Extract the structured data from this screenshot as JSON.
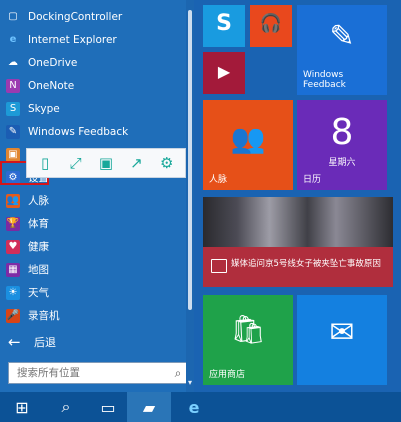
{
  "apps": [
    {
      "label": "DockingController",
      "icon": "app-icon",
      "color": "#1f6eb9"
    },
    {
      "label": "Internet Explorer",
      "icon": "internet-explorer-icon",
      "color": "#2f7ad5"
    },
    {
      "label": "OneDrive",
      "icon": "cloud-icon",
      "color": "#2b7ad1"
    },
    {
      "label": "OneNote",
      "icon": "onenote-icon",
      "color": "#9b3ab0"
    },
    {
      "label": "Skype",
      "icon": "skype-icon",
      "color": "#1d9ad7"
    },
    {
      "label": "Windows Feedback",
      "icon": "feedback-icon",
      "color": "#1b5db3"
    },
    {
      "label": "",
      "icon": "blank",
      "color": "#1f6eb9"
    },
    {
      "label": "设置",
      "icon": "gear-icon",
      "color": "#2c6ad2"
    },
    {
      "label": "人脉",
      "icon": "people-icon",
      "color": "#e35b1c"
    },
    {
      "label": "体育",
      "icon": "trophy-icon",
      "color": "#7b2aa1"
    },
    {
      "label": "健康",
      "icon": "heart-icon",
      "color": "#d12e5a"
    },
    {
      "label": "地图",
      "icon": "map-icon",
      "color": "#7e2ba6"
    },
    {
      "label": "天气",
      "icon": "sun-icon",
      "color": "#1a8fe0"
    },
    {
      "label": "录音机",
      "icon": "mic-icon",
      "color": "#d74416"
    }
  ],
  "toolbar": [
    {
      "name": "tablet-icon",
      "glyph": "▯"
    },
    {
      "name": "expand-icon",
      "glyph": "⤢"
    },
    {
      "name": "save-icon",
      "glyph": "▣"
    },
    {
      "name": "share-icon",
      "glyph": "↗"
    },
    {
      "name": "gear-icon",
      "glyph": "⚙"
    }
  ],
  "back": {
    "label": "后退"
  },
  "search": {
    "placeholder": "搜索所有位置"
  },
  "tiles": {
    "skype": {
      "glyph": "S",
      "color": "#199be0"
    },
    "music": {
      "glyph": "🎧",
      "color": "#e9481d"
    },
    "video": {
      "glyph": "▶",
      "color": "#a31a3a"
    },
    "feedback": {
      "label_line1": "Windows",
      "label_line2": "Feedback",
      "color": "#1a6fd6"
    },
    "people": {
      "label": "人脉",
      "color": "#e65018"
    },
    "calendar": {
      "number": "8",
      "weekday": "星期六",
      "label": "日历",
      "color": "#6a2bb8"
    },
    "news": {
      "text": "媒体追问京5号线女子被夹坠亡事故原因",
      "color": "#b02e3d"
    },
    "store": {
      "label": "应用商店",
      "color": "#1fa24a"
    },
    "mail": {
      "color": "#1480e0"
    }
  },
  "taskbar": [
    {
      "name": "start-button",
      "glyph": "⊞"
    },
    {
      "name": "search-taskbar-icon",
      "glyph": "⚲"
    },
    {
      "name": "task-view-icon",
      "glyph": "▭"
    },
    {
      "name": "file-explorer-icon",
      "glyph": "▰"
    },
    {
      "name": "internet-explorer-taskbar-icon",
      "glyph": "e"
    }
  ]
}
